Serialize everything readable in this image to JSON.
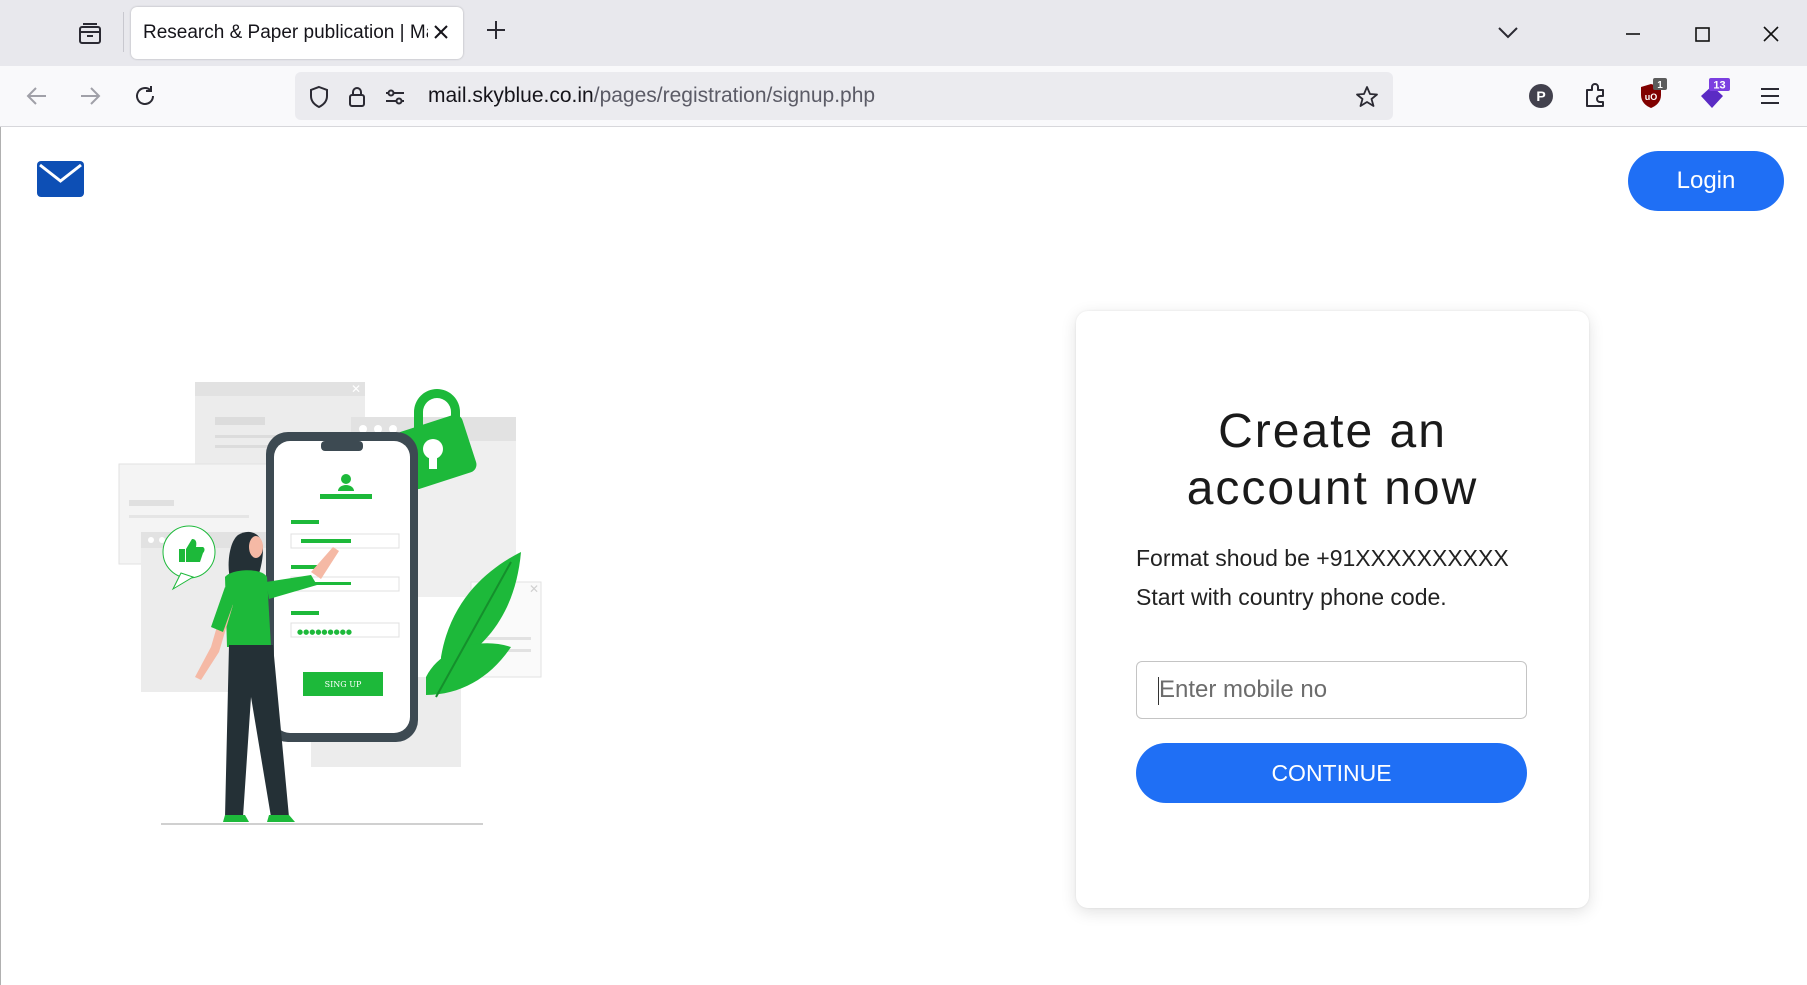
{
  "browser": {
    "tab_title": "Research & Paper publication | Mail",
    "url_host": "mail.skyblue.co.in",
    "url_path": "/pages/registration/signup.php",
    "extensions": {
      "ublock_badge": "1",
      "ext2_badge": "13",
      "profile_letter": "P"
    }
  },
  "page": {
    "login_label": "Login",
    "card": {
      "title_line1": "Create an",
      "title_line2": "account now",
      "format_hint": "Format shoud be +91XXXXXXXXXX",
      "country_hint": "Start with country phone code.",
      "mobile_placeholder": "Enter mobile no",
      "continue_label": "CONTINUE"
    },
    "illustration": {
      "signup_button_text": "SING UP",
      "password_dots": "●●●●●●●●●"
    }
  },
  "colors": {
    "accent": "#1f6ff5",
    "illustration_green": "#1db93a",
    "logo_blue": "#0d4fb5"
  }
}
